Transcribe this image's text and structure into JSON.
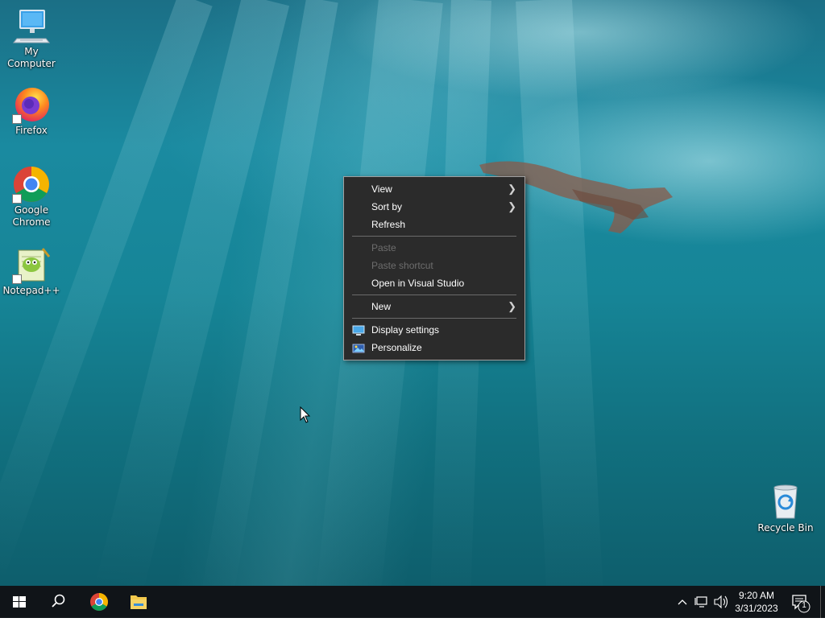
{
  "desktop_icons": {
    "my_computer": "My Computer",
    "firefox": "Firefox",
    "chrome": "Google Chrome",
    "notepadpp": "Notepad++",
    "recycle_bin": "Recycle Bin"
  },
  "context_menu": {
    "view": "View",
    "sort_by": "Sort by",
    "refresh": "Refresh",
    "paste": "Paste",
    "paste_shortcut": "Paste shortcut",
    "open_in_vs": "Open in Visual Studio",
    "new": "New",
    "display_settings": "Display settings",
    "personalize": "Personalize"
  },
  "taskbar": {
    "time": "9:20 AM",
    "date": "3/31/2023",
    "notification_count": "1"
  }
}
